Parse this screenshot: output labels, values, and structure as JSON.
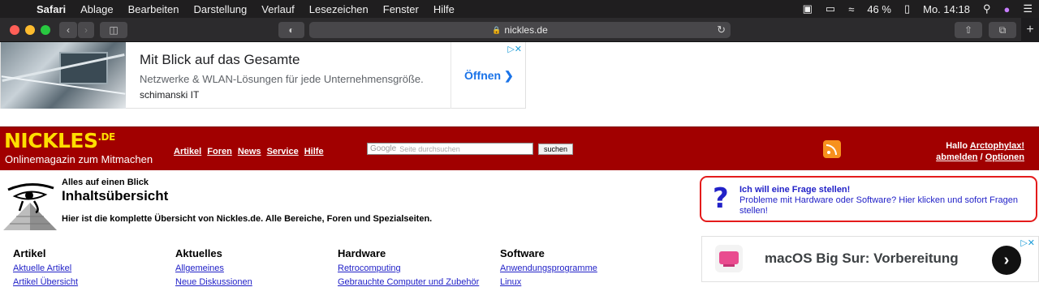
{
  "menubar": {
    "apple_icon": "apple-logo-icon",
    "items": [
      "Safari",
      "Ablage",
      "Bearbeiten",
      "Darstellung",
      "Verlauf",
      "Lesezeichen",
      "Fenster",
      "Hilfe"
    ],
    "battery": "46 %",
    "clock": "Mo. 14:18"
  },
  "safari": {
    "url": "nickles.de"
  },
  "ad_top": {
    "title": "Mit Blick auf das Gesamte",
    "description": "Netzwerke & WLAN-Lösungen für jede Unternehmensgröße.",
    "advertiser": "schimanski IT",
    "cta": "Öffnen",
    "adchoices": "▷✕"
  },
  "site": {
    "logo": "NICKLES",
    "logo_tld": ".DE",
    "tagline": "Onlinemagazin zum Mitmachen",
    "nav": [
      "Artikel",
      "Foren",
      "News",
      "Service",
      "Hilfe"
    ],
    "search_brand": "Google",
    "search_placeholder": "Seite durchsuchen",
    "search_button": "suchen",
    "greeting": "Hallo",
    "username": "Arctophylax!",
    "logout": "abmelden",
    "options_sep": "/",
    "options": "Optionen"
  },
  "overview": {
    "kicker": "Alles auf einen Blick",
    "title": "Inhaltsübersicht",
    "description": "Hier ist die komplette Übersicht von Nickles.de. Alle Bereiche, Foren und Spezialseiten."
  },
  "question_box": {
    "title": "Ich will eine Frage stellen!",
    "text": "Probleme mit Hardware oder Software? Hier klicken und sofort Fragen stellen!"
  },
  "columns": [
    {
      "heading": "Artikel",
      "links": [
        "Aktuelle Artikel",
        "Artikel Übersicht"
      ]
    },
    {
      "heading": "Aktuelles",
      "links": [
        "Allgemeines",
        "Neue Diskussionen"
      ]
    },
    {
      "heading": "Hardware",
      "links": [
        "Retrocomputing",
        "Gebrauchte Computer und Zubehör"
      ]
    },
    {
      "heading": "Software",
      "links": [
        "Anwendungsprogramme",
        "Linux"
      ]
    }
  ],
  "ad_bottom": {
    "title": "macOS Big Sur: Vorbereitung",
    "adchoices": "▷✕"
  },
  "colors": {
    "header_red": "#a10000",
    "logo_yellow": "#ffdd00",
    "link_blue": "#2222c8",
    "question_border": "#e41b1b"
  }
}
